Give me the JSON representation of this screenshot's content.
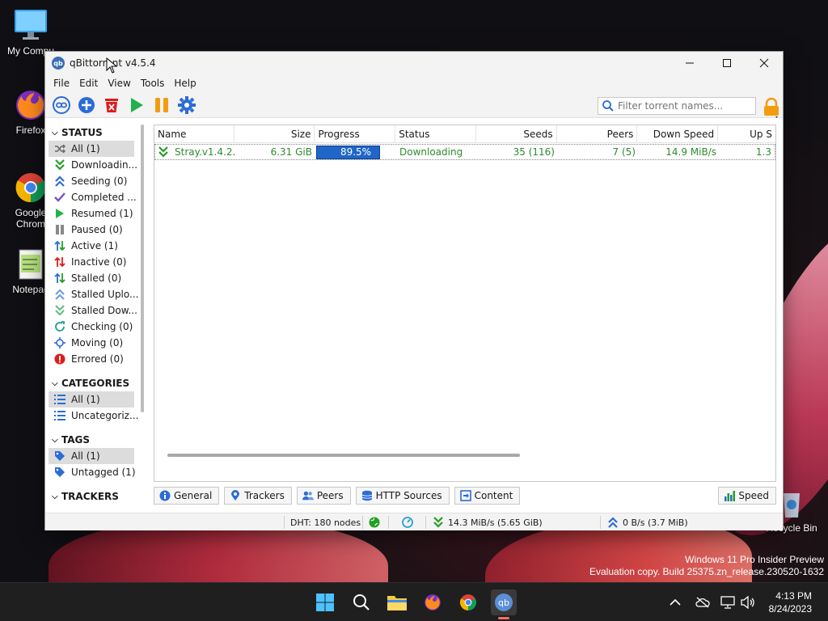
{
  "desktop": {
    "icons": [
      {
        "label": "My Compu"
      },
      {
        "label": "Firefox"
      },
      {
        "label": "Google Chrom"
      },
      {
        "label": "Notepad"
      },
      {
        "label": "Recycle Bin"
      }
    ]
  },
  "window": {
    "title": "qBittorrent v4.5.4",
    "icon_text": "qb"
  },
  "menu": [
    "File",
    "Edit",
    "View",
    "Tools",
    "Help"
  ],
  "search": {
    "placeholder": "Filter torrent names..."
  },
  "sidebar": {
    "status_title": "STATUS",
    "status_items": [
      {
        "label": "All (1)",
        "icon": "shuffle-icon",
        "selected": true
      },
      {
        "label": "Downloadin...",
        "icon": "download-chevron-icon"
      },
      {
        "label": "Seeding (0)",
        "icon": "upload-chevron-icon"
      },
      {
        "label": "Completed ...",
        "icon": "check-icon"
      },
      {
        "label": "Resumed (1)",
        "icon": "play-icon"
      },
      {
        "label": "Paused (0)",
        "icon": "pause-icon"
      },
      {
        "label": "Active (1)",
        "icon": "active-arrows-icon"
      },
      {
        "label": "Inactive (0)",
        "icon": "inactive-arrows-icon"
      },
      {
        "label": "Stalled (0)",
        "icon": "stalled-arrows-icon"
      },
      {
        "label": "Stalled Uplo...",
        "icon": "stalled-upload-icon"
      },
      {
        "label": "Stalled Dow...",
        "icon": "stalled-download-icon"
      },
      {
        "label": "Checking (0)",
        "icon": "refresh-icon"
      },
      {
        "label": "Moving (0)",
        "icon": "moving-icon"
      },
      {
        "label": "Errored (0)",
        "icon": "error-icon"
      }
    ],
    "categories_title": "CATEGORIES",
    "categories_items": [
      {
        "label": "All (1)",
        "selected": true
      },
      {
        "label": "Uncategoriz..."
      }
    ],
    "tags_title": "TAGS",
    "tags_items": [
      {
        "label": "All (1)",
        "selected": true
      },
      {
        "label": "Untagged (1)"
      }
    ],
    "trackers_title": "TRACKERS"
  },
  "torrents": {
    "columns": [
      "Name",
      "Size",
      "Progress",
      "Status",
      "Seeds",
      "Peers",
      "Down Speed",
      "Up S"
    ],
    "rows": [
      {
        "name": "Stray.v1.4.2...",
        "size": "6.31 GiB",
        "progress_text": "89.5%",
        "progress_value": 0.895,
        "status": "Downloading",
        "seeds": "35 (116)",
        "peers": "7 (5)",
        "down_speed": "14.9 MiB/s",
        "up_speed": "1.3"
      }
    ]
  },
  "tabs": [
    "General",
    "Trackers",
    "Peers",
    "HTTP Sources",
    "Content"
  ],
  "speed_tab": "Speed",
  "statusbar": {
    "dht": "DHT: 180 nodes",
    "download": "14.3 MiB/s (5.65 GiB)",
    "upload": "0 B/s (3.7 MiB)"
  },
  "watermark": {
    "line1": "Windows 11 Pro Insider Preview",
    "line2": "Evaluation copy. Build 25375.zn_release.230520-1632"
  },
  "clock": {
    "time": "4:13 PM",
    "date": "8/24/2023"
  },
  "colors": {
    "accent": "#1f66c8",
    "download_green": "#2e8b2e",
    "error_red": "#e01b1b",
    "upload_blue": "#2b6cd6"
  }
}
